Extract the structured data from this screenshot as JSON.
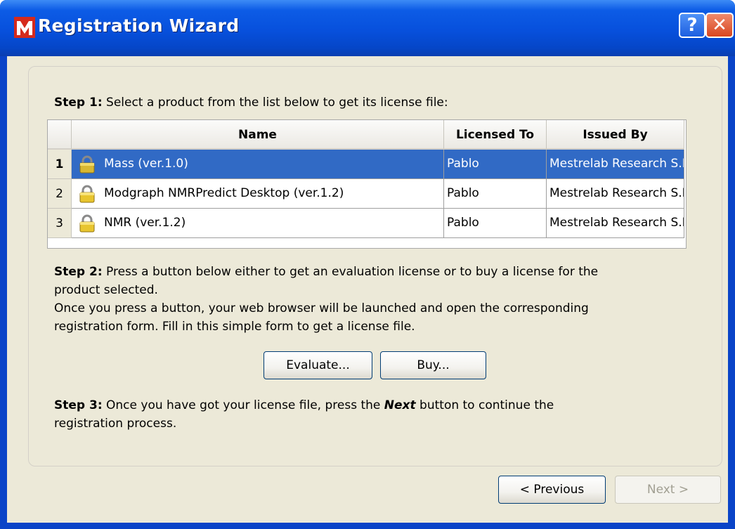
{
  "window": {
    "title": "Registration Wizard"
  },
  "step1": {
    "label": "Step 1:",
    "text": " Select a product from the list below to get its license file:"
  },
  "table": {
    "columns": [
      "Name",
      "Licensed To",
      "Issued By"
    ],
    "rows": [
      {
        "num": "1",
        "name": "Mass (ver.1.0)",
        "licensed_to": "Pablo",
        "issued_by": "Mestrelab Research S.L.",
        "selected": true
      },
      {
        "num": "2",
        "name": "Modgraph NMRPredict Desktop (ver.1.2)",
        "licensed_to": "Pablo",
        "issued_by": "Mestrelab Research S.L.",
        "selected": false
      },
      {
        "num": "3",
        "name": "NMR (ver.1.2)",
        "licensed_to": "Pablo",
        "issued_by": "Mestrelab Research S.L.",
        "selected": false
      }
    ]
  },
  "step2": {
    "label": "Step 2:",
    "line1": " Press a button below either to get an evaluation license or to buy a license for the",
    "line2": "product selected.",
    "line3": "Once you press a button, your web browser will be launched and open the corresponding",
    "line4": "registration form. Fill in this simple form to get a license file."
  },
  "buttons": {
    "evaluate": "Evaluate...",
    "buy": "Buy...",
    "previous": "< Previous",
    "next": "Next >"
  },
  "step3": {
    "label": "Step 3:",
    "text_a": " Once you have got your license file, press the ",
    "next_word": "Next",
    "text_b": " button to continue the",
    "line2": "registration process."
  },
  "colors": {
    "titlebar": "#0750dc",
    "selection": "#316ac5",
    "face": "#ece9d8"
  },
  "icons": {
    "app": "mestrelab-m-icon",
    "help": "help-icon",
    "close": "close-icon",
    "row": "lock-icon"
  }
}
